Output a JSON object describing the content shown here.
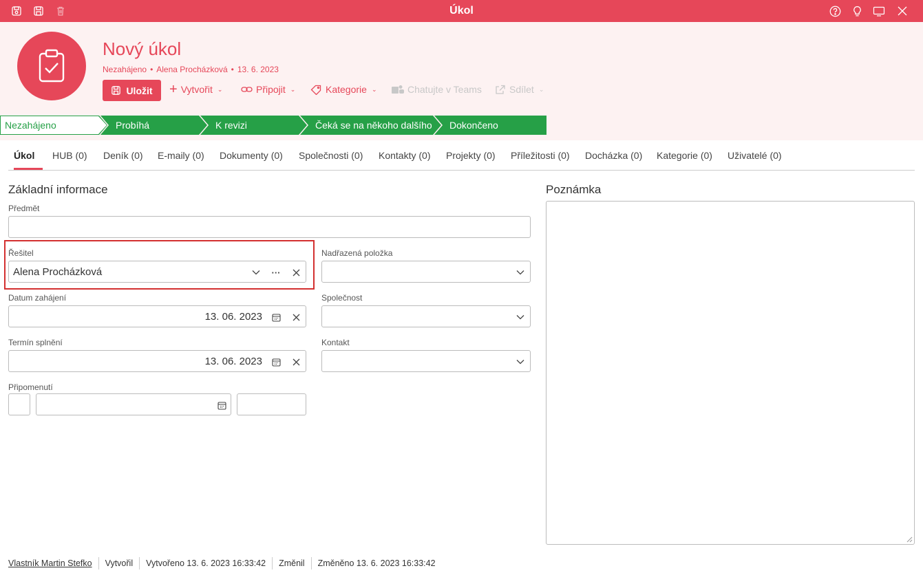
{
  "window": {
    "title": "Úkol"
  },
  "header": {
    "title": "Nový úkol",
    "status": "Nezahájeno",
    "owner": "Alena Procházková",
    "date": "13. 6. 2023",
    "separator": "•",
    "actions": {
      "save": "Uložit",
      "create": "Vytvořit",
      "attach": "Připojit",
      "category": "Kategorie",
      "teams": "Chatujte v Teams",
      "share": "Sdílet"
    }
  },
  "stages": [
    "Nezahájeno",
    "Probíhá",
    "K revizi",
    "Čeká se na někoho dalšího",
    "Dokončeno"
  ],
  "tabs": [
    "Úkol",
    "HUB (0)",
    "Deník (0)",
    "E-maily (0)",
    "Dokumenty (0)",
    "Společnosti (0)",
    "Kontakty (0)",
    "Projekty (0)",
    "Příležitosti (0)",
    "Docházka (0)",
    "Kategorie (0)",
    "Uživatelé (0)"
  ],
  "form": {
    "section_title": "Základní informace",
    "subject_label": "Předmět",
    "subject_value": "",
    "assignee_label": "Řešitel",
    "assignee_value": "Alena Procházková",
    "parent_label": "Nadřazená položka",
    "start_label": "Datum zahájení",
    "start_value": "13. 06. 2023",
    "company_label": "Společnost",
    "due_label": "Termín splnění",
    "due_value": "13. 06. 2023",
    "contact_label": "Kontakt",
    "reminder_label": "Připomenutí"
  },
  "note": {
    "title": "Poznámka"
  },
  "footer": {
    "owner": "Vlastník Martin Stefko",
    "created_by": "Vytvořil",
    "created": "Vytvořeno 13. 6. 2023 16:33:42",
    "modified_by": "Změnil",
    "modified": "Změněno 13. 6. 2023 16:33:42"
  },
  "colors": {
    "accent": "#e64759",
    "stage_green": "#26a047",
    "header_bg": "#fdf2f2"
  }
}
